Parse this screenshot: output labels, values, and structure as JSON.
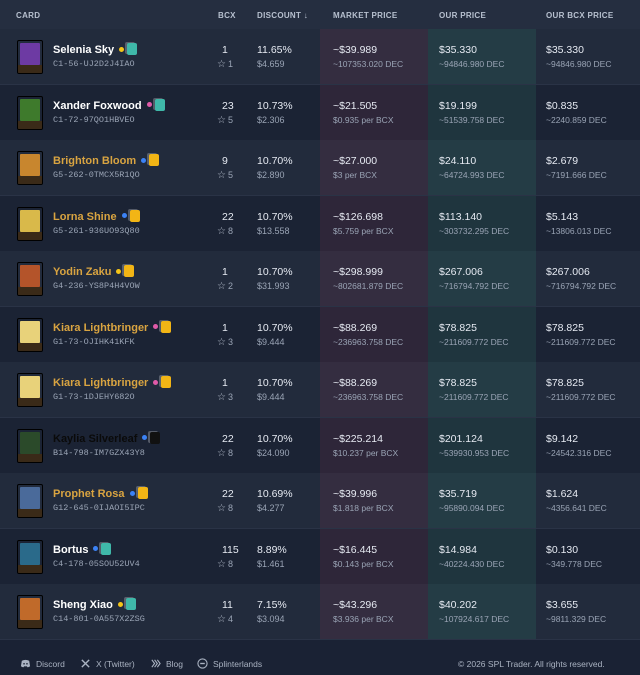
{
  "header": {
    "card": "CARD",
    "bcx": "BCX",
    "discount": "DISCOUNT ↓",
    "market_price": "MARKET PRICE",
    "our_price": "OUR PRICE",
    "our_bcx_price": "OUR BCX PRICE"
  },
  "rows": [
    {
      "name": "Selenia Sky",
      "uid": "C1-56-UJ2D2J4IAO",
      "bcx": "1",
      "level": "1",
      "discount": "11.65%",
      "discount_usd": "$4.659",
      "market": "~$39.989",
      "market_sub": "~107353.020 DEC",
      "our": "$35.330",
      "our_sub": "~94846.980 DEC",
      "our_bcx": "$35.330",
      "our_bcx_sub": "~94846.980 DEC",
      "name_color": "#ffffff",
      "dot_color": "#f5c518",
      "edition_color": "#3fb8a9",
      "art": "#6d3aa3"
    },
    {
      "name": "Xander Foxwood",
      "uid": "C1-72-97QO1HBVEO",
      "bcx": "23",
      "level": "5",
      "discount": "10.73%",
      "discount_usd": "$2.306",
      "market": "~$21.505",
      "market_sub": "$0.935 per BCX",
      "our": "$19.199",
      "our_sub": "~51539.758 DEC",
      "our_bcx": "$0.835",
      "our_bcx_sub": "~2240.859 DEC",
      "name_color": "#ffffff",
      "dot_color": "#e05aa8",
      "edition_color": "#3fb8a9",
      "art": "#3e7a2c"
    },
    {
      "name": "Brighton Bloom",
      "uid": "G5-262-0TMCX5R1QO",
      "bcx": "9",
      "level": "5",
      "discount": "10.70%",
      "discount_usd": "$2.890",
      "market": "~$27.000",
      "market_sub": "$3 per BCX",
      "our": "$24.110",
      "our_sub": "~64724.993 DEC",
      "our_bcx": "$2.679",
      "our_bcx_sub": "~7191.666 DEC",
      "name_color": "#d9a441",
      "dot_color": "#3b82f6",
      "edition_color": "#f2b515",
      "art": "#c8862e"
    },
    {
      "name": "Lorna Shine",
      "uid": "G5-261-936UO93Q80",
      "bcx": "22",
      "level": "8",
      "discount": "10.70%",
      "discount_usd": "$13.558",
      "market": "~$126.698",
      "market_sub": "$5.759 per BCX",
      "our": "$113.140",
      "our_sub": "~303732.295 DEC",
      "our_bcx": "$5.143",
      "our_bcx_sub": "~13806.013 DEC",
      "name_color": "#d9a441",
      "dot_color": "#3b82f6",
      "edition_color": "#f2b515",
      "art": "#d9b94a"
    },
    {
      "name": "Yodin Zaku",
      "uid": "G4-236-YS8P4H4VOW",
      "bcx": "1",
      "level": "2",
      "discount": "10.70%",
      "discount_usd": "$31.993",
      "market": "~$298.999",
      "market_sub": "~802681.879 DEC",
      "our": "$267.006",
      "our_sub": "~716794.792 DEC",
      "our_bcx": "$267.006",
      "our_bcx_sub": "~716794.792 DEC",
      "name_color": "#d9a441",
      "dot_color": "#f5c518",
      "edition_color": "#f2b515",
      "art": "#b4542a"
    },
    {
      "name": "Kiara Lightbringer",
      "uid": "G1-73-OJIHK41KFK",
      "bcx": "1",
      "level": "3",
      "discount": "10.70%",
      "discount_usd": "$9.444",
      "market": "~$88.269",
      "market_sub": "~236963.758 DEC",
      "our": "$78.825",
      "our_sub": "~211609.772 DEC",
      "our_bcx": "$78.825",
      "our_bcx_sub": "~211609.772 DEC",
      "name_color": "#d9a441",
      "dot_color": "#e05aa8",
      "edition_color": "#f2b515",
      "art": "#e8d27a"
    },
    {
      "name": "Kiara Lightbringer",
      "uid": "G1-73-1DJEHY682O",
      "bcx": "1",
      "level": "3",
      "discount": "10.70%",
      "discount_usd": "$9.444",
      "market": "~$88.269",
      "market_sub": "~236963.758 DEC",
      "our": "$78.825",
      "our_sub": "~211609.772 DEC",
      "our_bcx": "$78.825",
      "our_bcx_sub": "~211609.772 DEC",
      "name_color": "#d9a441",
      "dot_color": "#e05aa8",
      "edition_color": "#f2b515",
      "art": "#e8d27a"
    },
    {
      "name": "Kaylia Silverleaf",
      "uid": "B14-798-IM7GZX43Y8",
      "bcx": "22",
      "level": "8",
      "discount": "10.70%",
      "discount_usd": "$24.090",
      "market": "~$225.214",
      "market_sub": "$10.237 per BCX",
      "our": "$201.124",
      "our_sub": "~539930.953 DEC",
      "our_bcx": "$9.142",
      "our_bcx_sub": "~24542.316 DEC",
      "name_color": "#0a0a0a",
      "dot_color": "#3b82f6",
      "edition_color": "#111111",
      "art": "#2b4a2a"
    },
    {
      "name": "Prophet Rosa",
      "uid": "G12-645-0IJAOI5IPC",
      "bcx": "22",
      "level": "8",
      "discount": "10.69%",
      "discount_usd": "$4.277",
      "market": "~$39.996",
      "market_sub": "$1.818 per BCX",
      "our": "$35.719",
      "our_sub": "~95890.094 DEC",
      "our_bcx": "$1.624",
      "our_bcx_sub": "~4356.641 DEC",
      "name_color": "#d9a441",
      "dot_color": "#3b82f6",
      "edition_color": "#f2b515",
      "art": "#4a6a9a"
    },
    {
      "name": "Bortus",
      "uid": "C4-178-05SOU52UV4",
      "bcx": "115",
      "level": "8",
      "discount": "8.89%",
      "discount_usd": "$1.461",
      "market": "~$16.445",
      "market_sub": "$0.143 per BCX",
      "our": "$14.984",
      "our_sub": "~40224.430 DEC",
      "our_bcx": "$0.130",
      "our_bcx_sub": "~349.778 DEC",
      "name_color": "#ffffff",
      "dot_color": "#3b82f6",
      "edition_color": "#3fb8a9",
      "art": "#2a6a8a"
    },
    {
      "name": "Sheng Xiao",
      "uid": "C14-801-0A557X2ZSG",
      "bcx": "11",
      "level": "4",
      "discount": "7.15%",
      "discount_usd": "$3.094",
      "market": "~$43.296",
      "market_sub": "$3.936 per BCX",
      "our": "$40.202",
      "our_sub": "~107924.617 DEC",
      "our_bcx": "$3.655",
      "our_bcx_sub": "~9811.329 DEC",
      "name_color": "#ffffff",
      "dot_color": "#f5c518",
      "edition_color": "#3fb8a9",
      "art": "#c06a2a"
    }
  ],
  "footer": {
    "discord": "Discord",
    "twitter": "X (Twitter)",
    "blog": "Blog",
    "splinterlands": "Splinterlands",
    "copyright": "© 2026 SPL Trader. All rights reserved."
  }
}
